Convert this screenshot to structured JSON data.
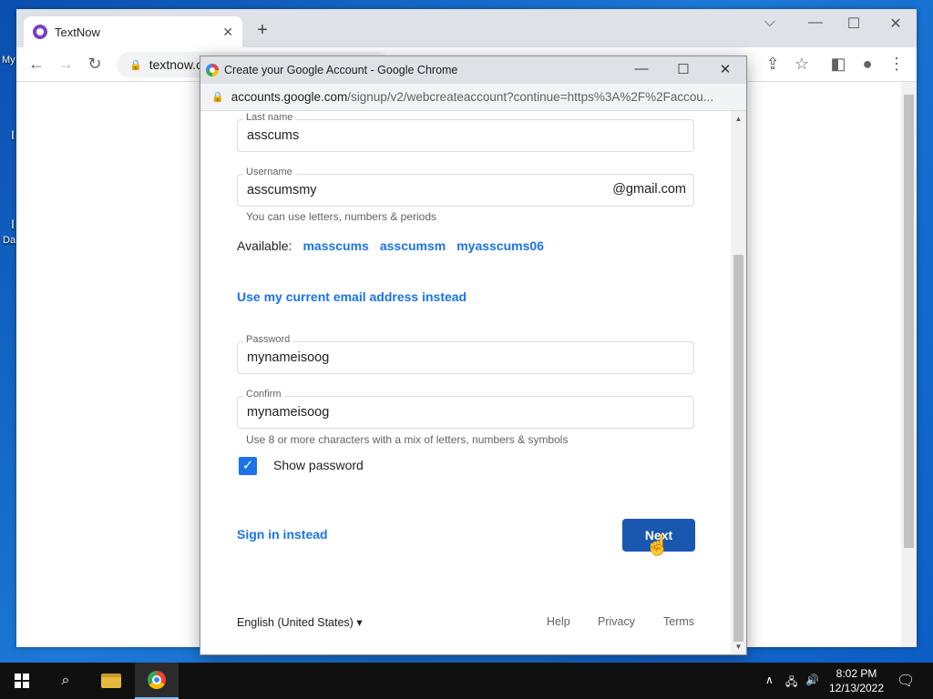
{
  "desktop": {
    "labels": [
      "My",
      "I",
      "I",
      "Da"
    ]
  },
  "bg_browser": {
    "tab_title": "TextNow",
    "tab_close": "✕",
    "new_tab": "+",
    "omnibox_text": "textnow.c",
    "controls": {
      "min": "—",
      "max": "☐",
      "close": "✕",
      "chevron": "⌵"
    }
  },
  "popup": {
    "title": "Create your Google Account - Google Chrome",
    "url_host": "accounts.google.com",
    "url_path": "/signup/v2/webcreateaccount?continue=https%3A%2F%2Faccou...",
    "controls": {
      "min": "—",
      "max": "☐",
      "close": "✕"
    }
  },
  "form": {
    "last_name": {
      "label": "Last name",
      "value": "asscums"
    },
    "username": {
      "label": "Username",
      "value": "asscumsmy",
      "suffix": "@gmail.com"
    },
    "username_hint": "You can use letters, numbers & periods",
    "available_label": "Available:",
    "suggestions": [
      "masscums",
      "asscumsm",
      "myasscums06"
    ],
    "use_email_link": "Use my current email address instead",
    "password": {
      "label": "Password",
      "value": "mynameisoog"
    },
    "confirm": {
      "label": "Confirm",
      "value": "mynameisoog"
    },
    "password_hint": "Use 8 or more characters with a mix of letters, numbers & symbols",
    "show_password": {
      "label": "Show password",
      "checked": true
    },
    "sign_in_link": "Sign in instead",
    "next_button": "Next"
  },
  "footer": {
    "language": "English (United States)",
    "links": [
      "Help",
      "Privacy",
      "Terms"
    ]
  },
  "taskbar": {
    "time": "8:02 PM",
    "date": "12/13/2022"
  },
  "colors": {
    "accent": "#1a73e8",
    "next_button": "#1a57b0",
    "checkbox": "#1a73e8"
  }
}
